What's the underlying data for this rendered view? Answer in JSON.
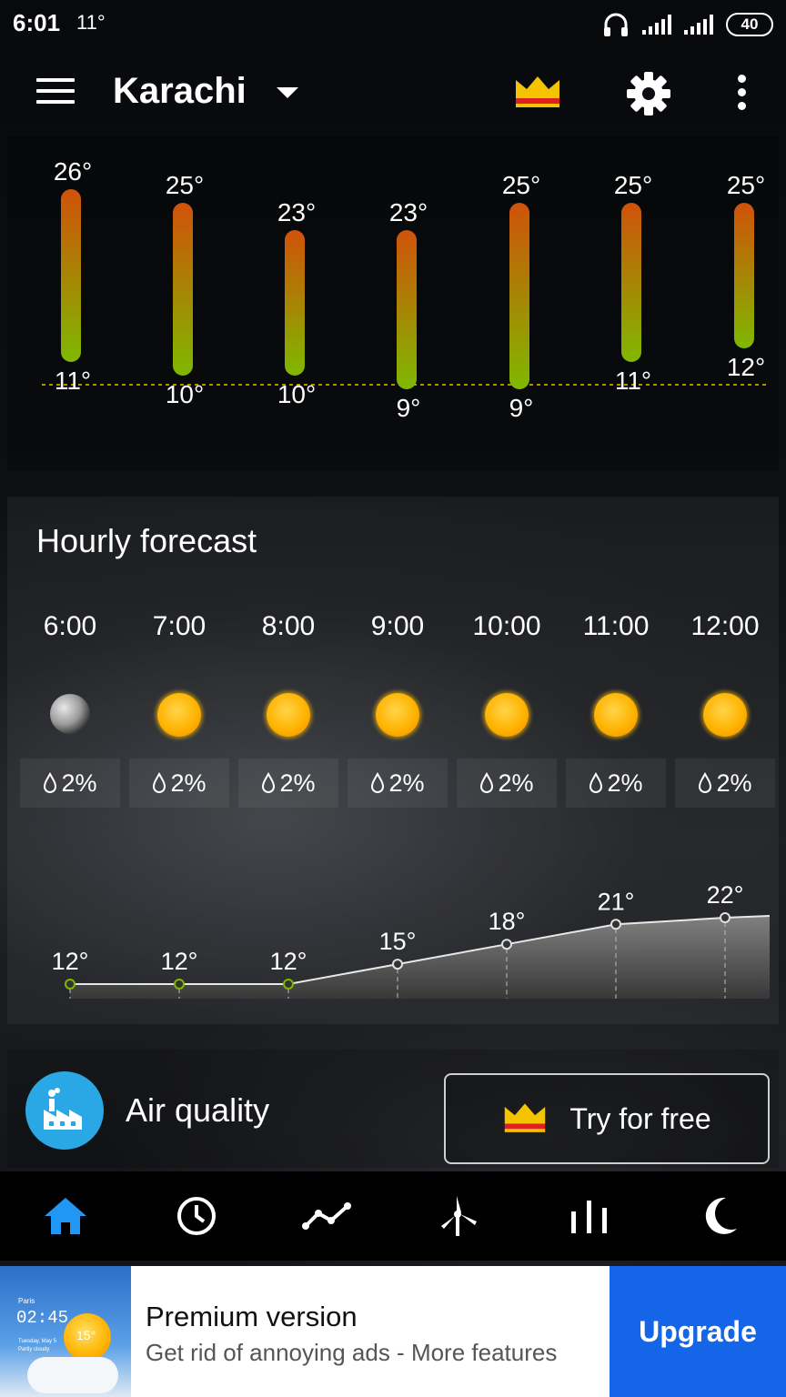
{
  "status_bar": {
    "time": "6:01",
    "temp": "11°",
    "battery": "40"
  },
  "app_bar": {
    "city": "Karachi"
  },
  "daily_chart": {
    "highs": [
      "26°",
      "25°",
      "23°",
      "23°",
      "25°",
      "25°",
      "25°"
    ],
    "lows": [
      "11°",
      "10°",
      "10°",
      "9°",
      "9°",
      "11°",
      "12°"
    ],
    "high_values": [
      26,
      25,
      23,
      23,
      25,
      25,
      25
    ],
    "low_values": [
      11,
      10,
      10,
      9,
      9,
      11,
      12
    ]
  },
  "hourly": {
    "title": "Hourly forecast",
    "items": [
      {
        "time": "6:00",
        "icon": "moon-icon",
        "precip": "2%",
        "temp": "12°",
        "value": 12
      },
      {
        "time": "7:00",
        "icon": "sun-icon",
        "precip": "2%",
        "temp": "12°",
        "value": 12
      },
      {
        "time": "8:00",
        "icon": "sun-icon",
        "precip": "2%",
        "temp": "12°",
        "value": 12
      },
      {
        "time": "9:00",
        "icon": "sun-icon",
        "precip": "2%",
        "temp": "15°",
        "value": 15
      },
      {
        "time": "10:00",
        "icon": "sun-icon",
        "precip": "2%",
        "temp": "18°",
        "value": 18
      },
      {
        "time": "11:00",
        "icon": "sun-icon",
        "precip": "2%",
        "temp": "21°",
        "value": 21
      },
      {
        "time": "12:00",
        "icon": "sun-icon",
        "precip": "2%",
        "temp": "22°",
        "value": 22
      }
    ]
  },
  "air_quality": {
    "label": "Air quality",
    "button": "Try for free"
  },
  "bottom_nav": [
    "home-icon",
    "clock-icon",
    "trend-icon",
    "wind-icon",
    "bars-icon",
    "moon-icon"
  ],
  "ad": {
    "image_city": "Paris",
    "image_time": "02:45",
    "image_temp": "15°",
    "image_date": "Tuesday, May 5",
    "image_cond": "Partly cloudy",
    "title": "Premium version",
    "subtitle": "Get rid of annoying ads - More features",
    "button": "Upgrade"
  },
  "colors": {
    "accent_blue": "#1565e8",
    "nav_active": "#2196f3",
    "air_icon_bg": "#2aa8e6",
    "bar_top": "#d0520a",
    "bar_bottom": "#7fb800"
  }
}
